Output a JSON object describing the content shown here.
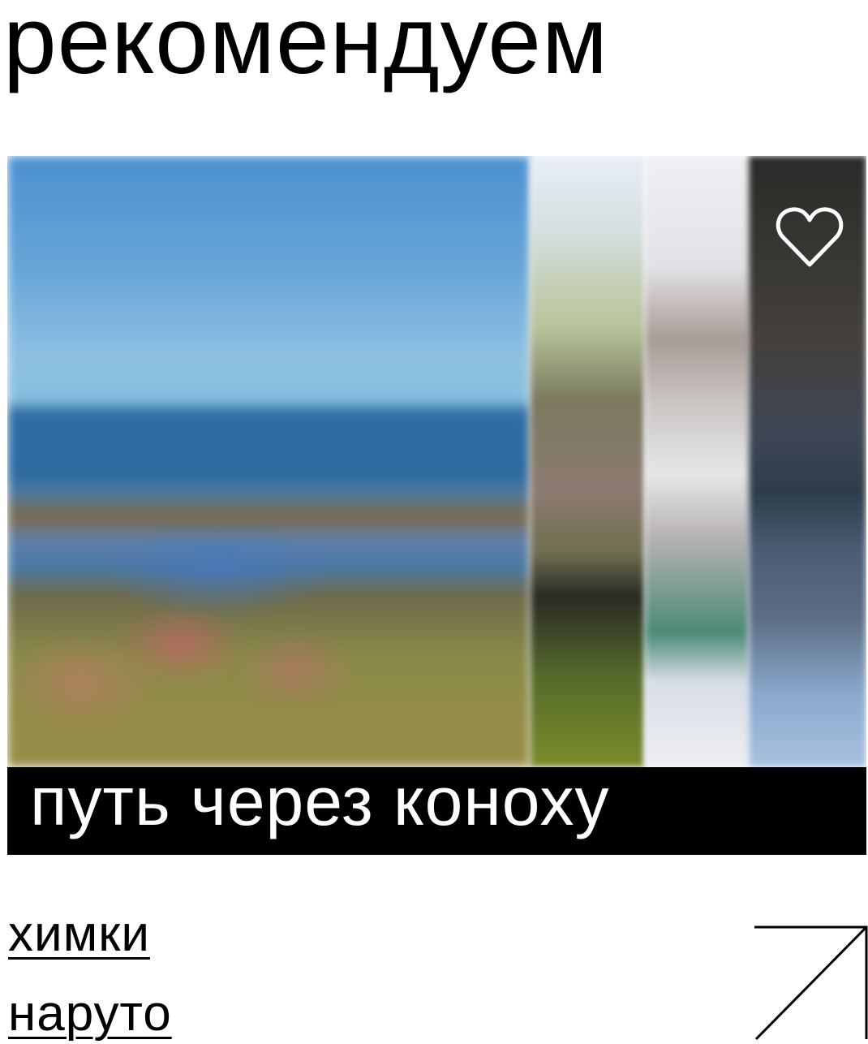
{
  "section": {
    "title": "рекомендуем"
  },
  "card": {
    "title": "путь через коноху",
    "favorite_icon": "heart-outline-icon",
    "photos": [
      {
        "name": "coastline"
      },
      {
        "name": "strip-2"
      },
      {
        "name": "strip-3"
      },
      {
        "name": "strip-4"
      }
    ]
  },
  "tags": [
    "химки",
    "наруто"
  ],
  "open_icon": "arrow-up-right-icon",
  "colors": {
    "background": "#ffffff",
    "text": "#000000",
    "caption_bg": "#000000",
    "caption_text": "#ffffff"
  }
}
